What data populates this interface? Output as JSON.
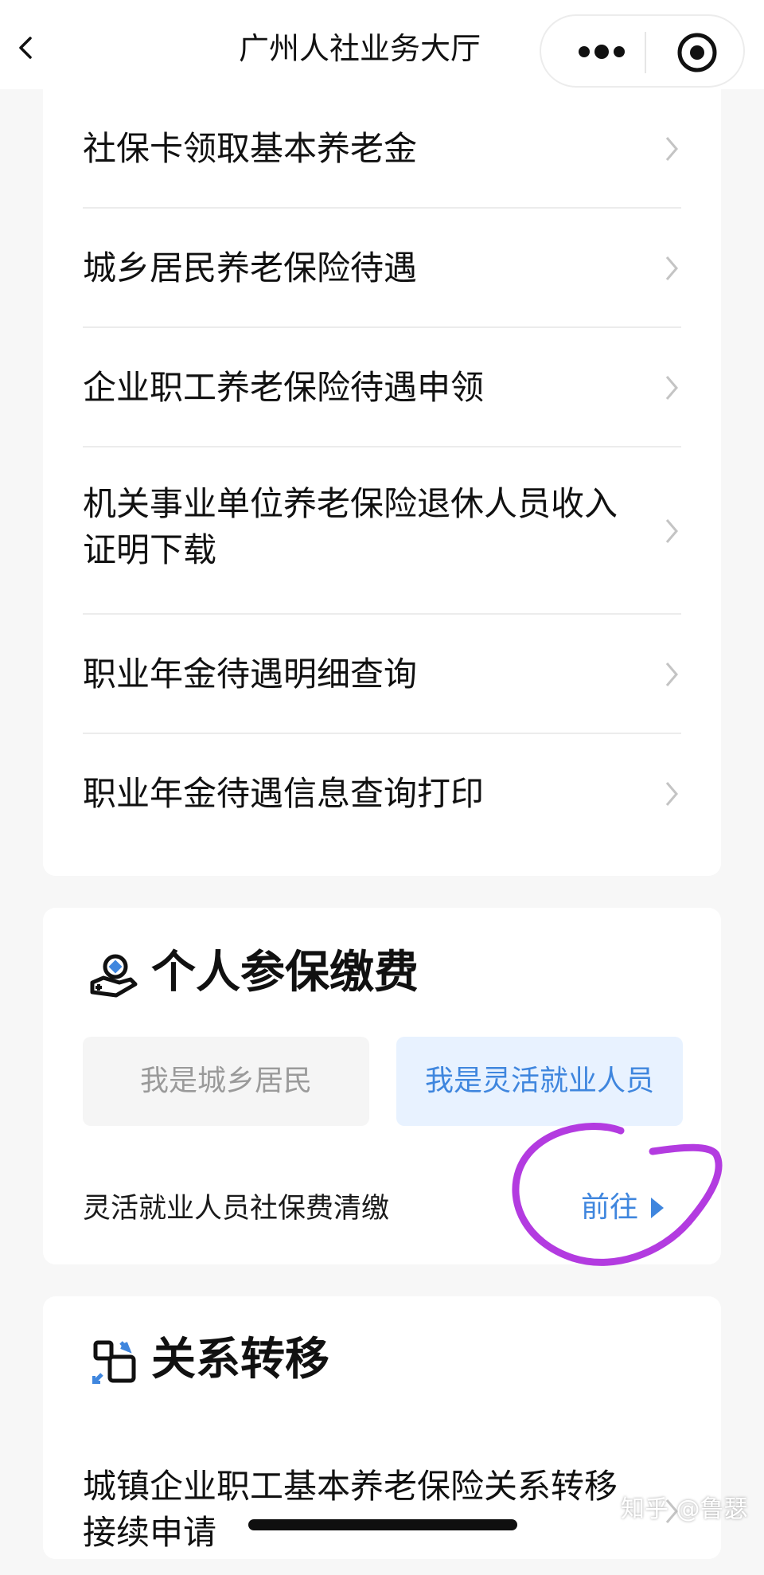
{
  "header": {
    "title": "广州人社业务大厅"
  },
  "pension_list": {
    "items": [
      {
        "label": "社保卡领取基本养老金"
      },
      {
        "label": "城乡居民养老保险待遇"
      },
      {
        "label": "企业职工养老保险待遇申领"
      },
      {
        "label": "机关事业单位养老保险退休人员收入证明下载"
      },
      {
        "label": "职业年金待遇明细查询"
      },
      {
        "label": "职业年金待遇信息查询打印"
      }
    ]
  },
  "payment_section": {
    "title": "个人参保缴费",
    "icon": "hand-coin-icon",
    "tabs": [
      {
        "label": "我是城乡居民",
        "selected": false
      },
      {
        "label": "我是灵活就业人员",
        "selected": true
      }
    ],
    "item_label": "灵活就业人员社保费清缴",
    "go_label": "前往"
  },
  "transfer_section": {
    "title": "关系转移",
    "icon": "transfer-icon",
    "items": [
      {
        "label": "城镇企业职工基本养老保险关系转移接续申请"
      }
    ]
  },
  "watermark": "知乎 @鲁瑟",
  "colors": {
    "accent": "#3f86de",
    "selected_tab_bg": "#e8f2ff",
    "annotation": "#b33be0"
  }
}
